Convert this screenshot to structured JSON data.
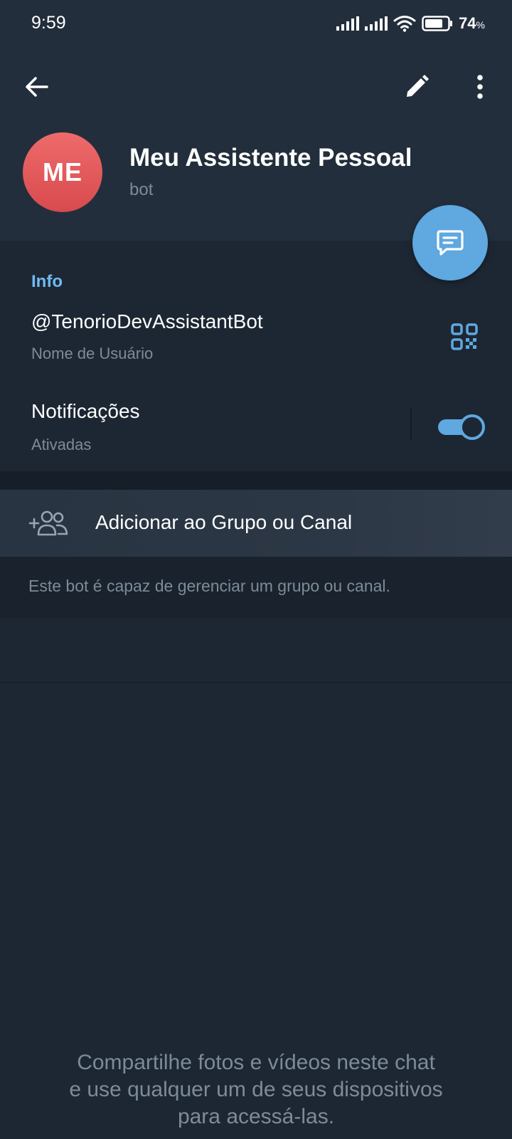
{
  "status_bar": {
    "time": "9:59",
    "battery_percent": "74",
    "battery_unit": "%",
    "icons": [
      "signal-icon",
      "signal-icon",
      "wifi-icon",
      "battery-icon"
    ]
  },
  "toolbar": {
    "icons": [
      "back-arrow-icon",
      "pencil-icon",
      "more-vertical-icon"
    ]
  },
  "profile": {
    "initials": "ME",
    "name": "Meu Assistente Pessoal",
    "status": "bot"
  },
  "fab": {
    "icon": "message-icon"
  },
  "info": {
    "title": "Info",
    "username": "@TenorioDevAssistantBot",
    "username_label": "Nome de Usuário",
    "notifications_title": "Notificações",
    "notifications_status": "Ativadas",
    "notifications_enabled": true
  },
  "actions": {
    "add_to_group_label": "Adicionar ao Grupo ou Canal",
    "add_to_group_icon": "add-users-icon",
    "hint": "Este bot é capaz de gerenciar um grupo ou canal."
  },
  "empty_state": {
    "line1": "Compartilhe fotos e vídeos neste chat",
    "line2": "e use qualquer um de seus dispositivos",
    "line3": "para acessá-las."
  },
  "colors": {
    "accent": "#5fa8e0",
    "section_title": "#71baf2",
    "avatar": "#e05a5c",
    "background": "#1d2733",
    "header": "#232e3c"
  }
}
